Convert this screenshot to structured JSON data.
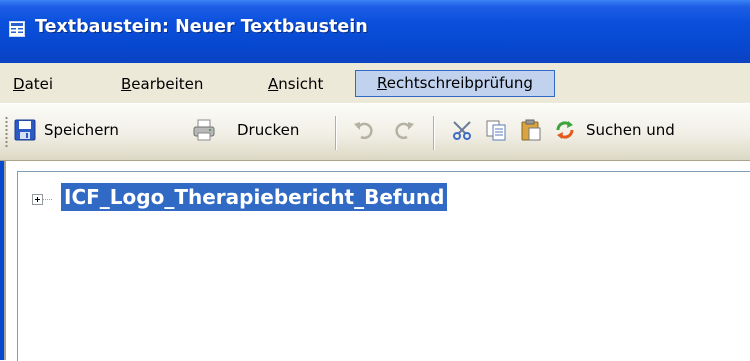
{
  "window": {
    "title": "Textbaustein: Neuer Textbaustein",
    "title_icon": "document-window-icon"
  },
  "menubar": {
    "items": [
      {
        "first": "D",
        "rest": "atei"
      },
      {
        "first": "B",
        "rest": "earbeiten"
      },
      {
        "first": "A",
        "rest": "nsicht"
      },
      {
        "first": "R",
        "rest": "echtschreibprüfung"
      }
    ],
    "active_item": "Rechtschreibprüfung"
  },
  "toolbar": {
    "save_label": "Speichern",
    "print_label": "Drucken",
    "search_label": "Suchen und",
    "icons": [
      "save-icon",
      "print-icon",
      "undo-icon",
      "redo-icon",
      "cut-icon",
      "copy-icon",
      "paste-icon",
      "search-replace-icon"
    ]
  },
  "tree": {
    "root_node": "ICF_Logo_Therapiebericht_Befund",
    "expanded": false,
    "selected": true
  },
  "colors": {
    "titlebar": "#0a50dc",
    "menu_bg": "#ece9d8",
    "selection": "#316ac5",
    "active_menu_bg": "#c1d2ee"
  }
}
